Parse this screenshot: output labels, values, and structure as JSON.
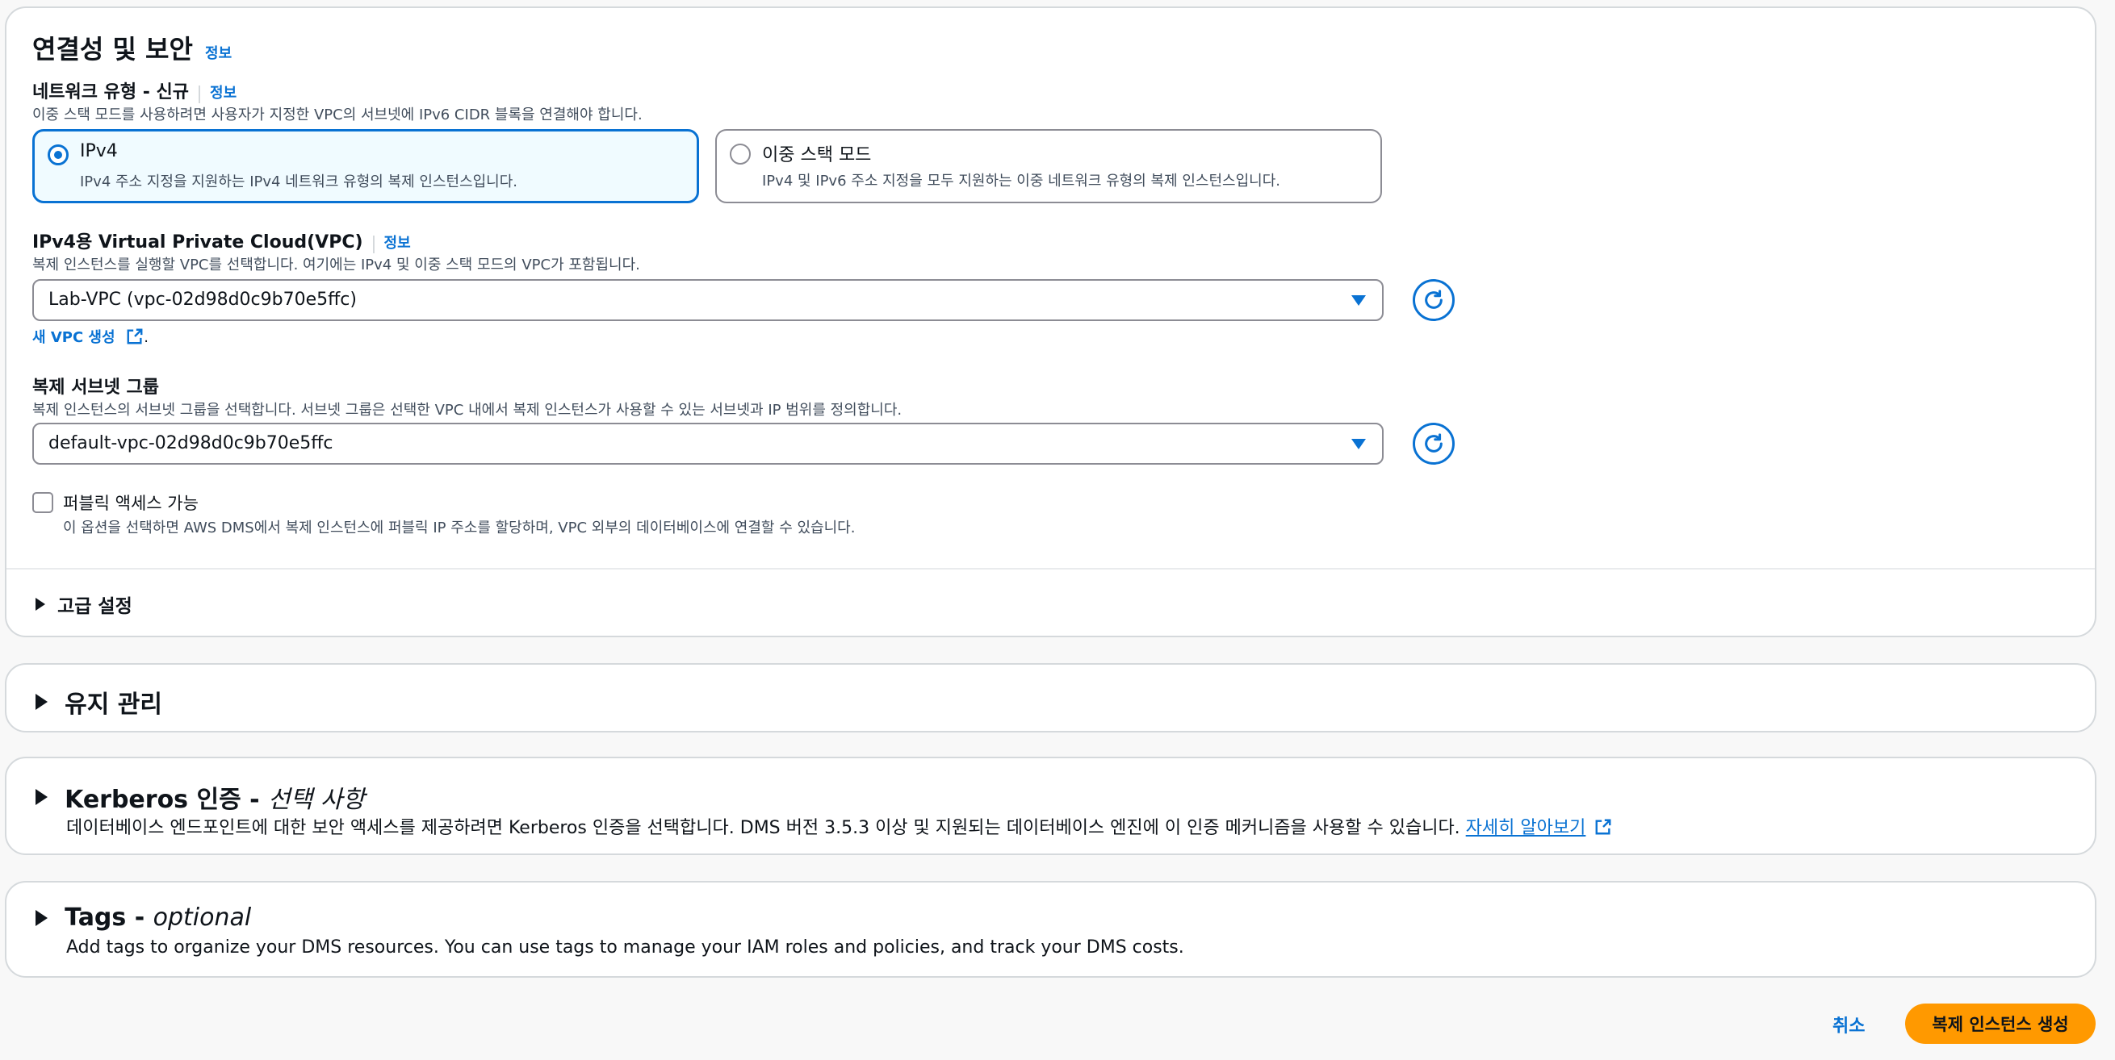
{
  "connectivity": {
    "title": "연결성 및 보안",
    "info": "정보",
    "network_type": {
      "label": "네트워크 유형 - 신규",
      "info": "정보",
      "description": "이중 스택 모드를 사용하려면 사용자가 지정한 VPC의 서브넷에 IPv6 CIDR 블록을 연결해야 합니다.",
      "options": [
        {
          "title": "IPv4",
          "description": "IPv4 주소 지정을 지원하는 IPv4 네트워크 유형의 복제 인스턴스입니다.",
          "selected": true
        },
        {
          "title": "이중 스택 모드",
          "description": "IPv4 및 IPv6 주소 지정을 모두 지원하는 이중 네트워크 유형의 복제 인스턴스입니다.",
          "selected": false
        }
      ]
    },
    "vpc": {
      "label": "IPv4용 Virtual Private Cloud(VPC)",
      "info": "정보",
      "description": "복제 인스턴스를 실행할 VPC를 선택합니다. 여기에는 IPv4 및 이중 스택 모드의 VPC가 포함됩니다.",
      "value": "Lab-VPC (vpc-02d98d0c9b70e5ffc)",
      "create_link": "새 VPC 생성",
      "create_suffix": "."
    },
    "subnet_group": {
      "label": "복제 서브넷 그룹",
      "description": "복제 인스턴스의 서브넷 그룹을 선택합니다. 서브넷 그룹은 선택한 VPC 내에서 복제 인스턴스가 사용할 수 있는 서브넷과 IP 범위를 정의합니다.",
      "value": "default-vpc-02d98d0c9b70e5ffc"
    },
    "public_access": {
      "label": "퍼블릭 액세스 가능",
      "description": "이 옵션을 선택하면 AWS DMS에서 복제 인스턴스에 퍼블릭 IP 주소를 할당하며, VPC 외부의 데이터베이스에 연결할 수 있습니다.",
      "checked": false
    },
    "advanced": "고급 설정"
  },
  "maintenance": {
    "title": "유지 관리"
  },
  "kerberos": {
    "title": "Kerberos 인증 - ",
    "title_em": "선택 사항",
    "description": "데이터베이스 엔드포인트에 대한 보안 액세스를 제공하려면 Kerberos 인증을 선택합니다. DMS 버전 3.5.3 이상 및 지원되는 데이터베이스 엔진에 이 인증 메커니즘을 사용할 수 있습니다.",
    "learn_more": "자세히 알아보기"
  },
  "tags": {
    "title": "Tags - ",
    "title_em": "optional",
    "description": "Add tags to organize your DMS resources. You can use tags to manage your IAM roles and policies, and track your DMS costs."
  },
  "actions": {
    "cancel": "취소",
    "create": "복제 인스턴스 생성"
  }
}
